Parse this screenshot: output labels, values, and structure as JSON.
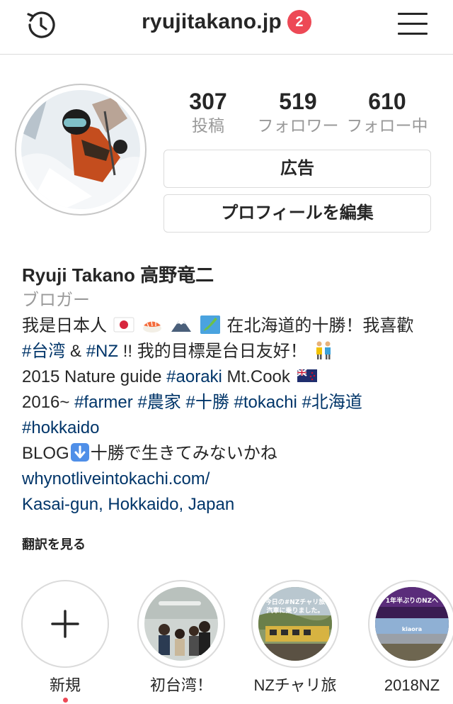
{
  "header": {
    "username": "ryujitakano.jp",
    "notification_count": "2",
    "history_icon": "history-clock-icon",
    "menu_icon": "hamburger-menu-icon"
  },
  "stats": [
    {
      "value": "307",
      "label": "投稿"
    },
    {
      "value": "519",
      "label": "フォロワー"
    },
    {
      "value": "610",
      "label": "フォロー中"
    }
  ],
  "buttons": {
    "ad_label": "広告",
    "edit_profile_label": "プロフィールを編集"
  },
  "bio": {
    "name": "Ryuji Takano 高野竜二",
    "category": "ブロガー",
    "line1_text": "我是日本人",
    "line1_emojis": [
      "japan-flag-emoji",
      "sushi-emoji",
      "mount-fuji-emoji",
      "map-of-japan-emoji"
    ],
    "line1_rest": "在北海道的十勝！我喜歡",
    "line2": {
      "tag1": "#台湾",
      "amp": " & ",
      "tag2": "#NZ",
      "text": " !! 我的目標是台日友好！",
      "emoji": "people-holding-hands-emoji"
    },
    "line3": {
      "text": "2015 Nature guide ",
      "tag": "#aoraki",
      "text2": " Mt.Cook",
      "emoji": "new-zealand-flag-emoji"
    },
    "line4": {
      "text": "2016~ ",
      "tags": [
        "#farmer",
        "#農家",
        "#十勝",
        "#tokachi",
        "#北海道"
      ]
    },
    "line5": {
      "tag": "#hokkaido"
    },
    "line6": {
      "text1": "BLOG",
      "emoji": "down-arrow-emoji",
      "text2": "十勝で生きてみないかね"
    },
    "website": "whynotliveintokachi.com/",
    "location": "Kasai-gun, Hokkaido, Japan",
    "translate": "翻訳を見る"
  },
  "highlights": [
    {
      "label": "新規",
      "icon": "plus-icon"
    },
    {
      "label": "初台湾！",
      "thumb_text": ""
    },
    {
      "label": "NZチャリ旅",
      "thumb_text": "今日の#NZチャリ旅 汽車に乗りました。"
    },
    {
      "label": "2018NZ",
      "thumb_text": "1年半ぶりのNZへ",
      "thumb_text2": "kiaora"
    }
  ],
  "colors": {
    "accent_link": "#003569",
    "badge_red": "#ed4956",
    "muted_gray": "#999999",
    "border": "#dbdbdb"
  }
}
